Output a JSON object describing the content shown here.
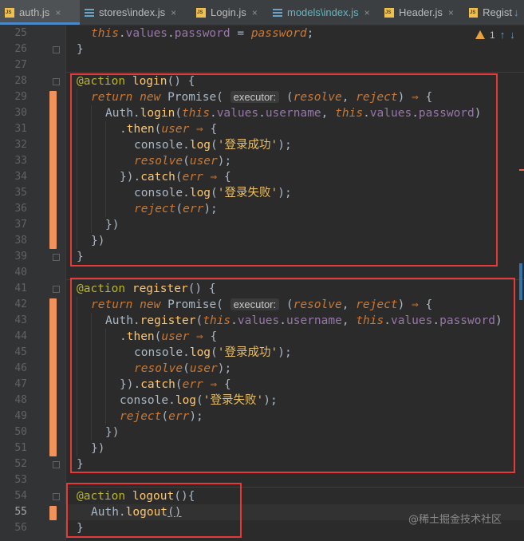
{
  "tabs": [
    {
      "label": "auth.js",
      "icon": "js-file-icon",
      "active": true
    },
    {
      "label": "stores\\index.js",
      "icon": "module-icon",
      "active": false
    },
    {
      "label": "Login.js",
      "icon": "js-file-icon",
      "active": false
    },
    {
      "label": "models\\index.js",
      "icon": "module-icon",
      "active": false
    },
    {
      "label": "Header.js",
      "icon": "js-file-icon",
      "active": false
    },
    {
      "label": "Regist",
      "icon": "js-file-icon",
      "active": false
    }
  ],
  "close_glyph": "×",
  "inspection": {
    "count": "1",
    "up": "↑",
    "down": "↓"
  },
  "top_right_arrow": "↓",
  "line_numbers": [
    "25",
    "26",
    "27",
    "28",
    "29",
    "30",
    "31",
    "32",
    "33",
    "34",
    "35",
    "36",
    "37",
    "38",
    "39",
    "40",
    "41",
    "42",
    "43",
    "44",
    "45",
    "46",
    "47",
    "48",
    "49",
    "50",
    "51",
    "52",
    "53",
    "54",
    "55",
    "56"
  ],
  "current_line": "55",
  "code": {
    "this": "this",
    "values": "values",
    "password": "password",
    "username": "username",
    "action": "@action",
    "login": "login",
    "register": "register",
    "logout": "logout",
    "return": "return",
    "new": "new",
    "Promise": "Promise",
    "executor": "executor:",
    "resolve": "resolve",
    "reject": "reject",
    "Auth": "Auth",
    "then": "then",
    "catch": "catch",
    "user": "user",
    "err": "err",
    "console": "console",
    "log": "log",
    "arrow": "⇒",
    "login_success": "'登录成功'",
    "login_fail": "'登录失败'"
  },
  "watermark": "@稀土掘金技术社区",
  "colors": {
    "highlight_box": "#e8393a",
    "accent": "#4a88c7",
    "change_marker": "#f0925a"
  }
}
